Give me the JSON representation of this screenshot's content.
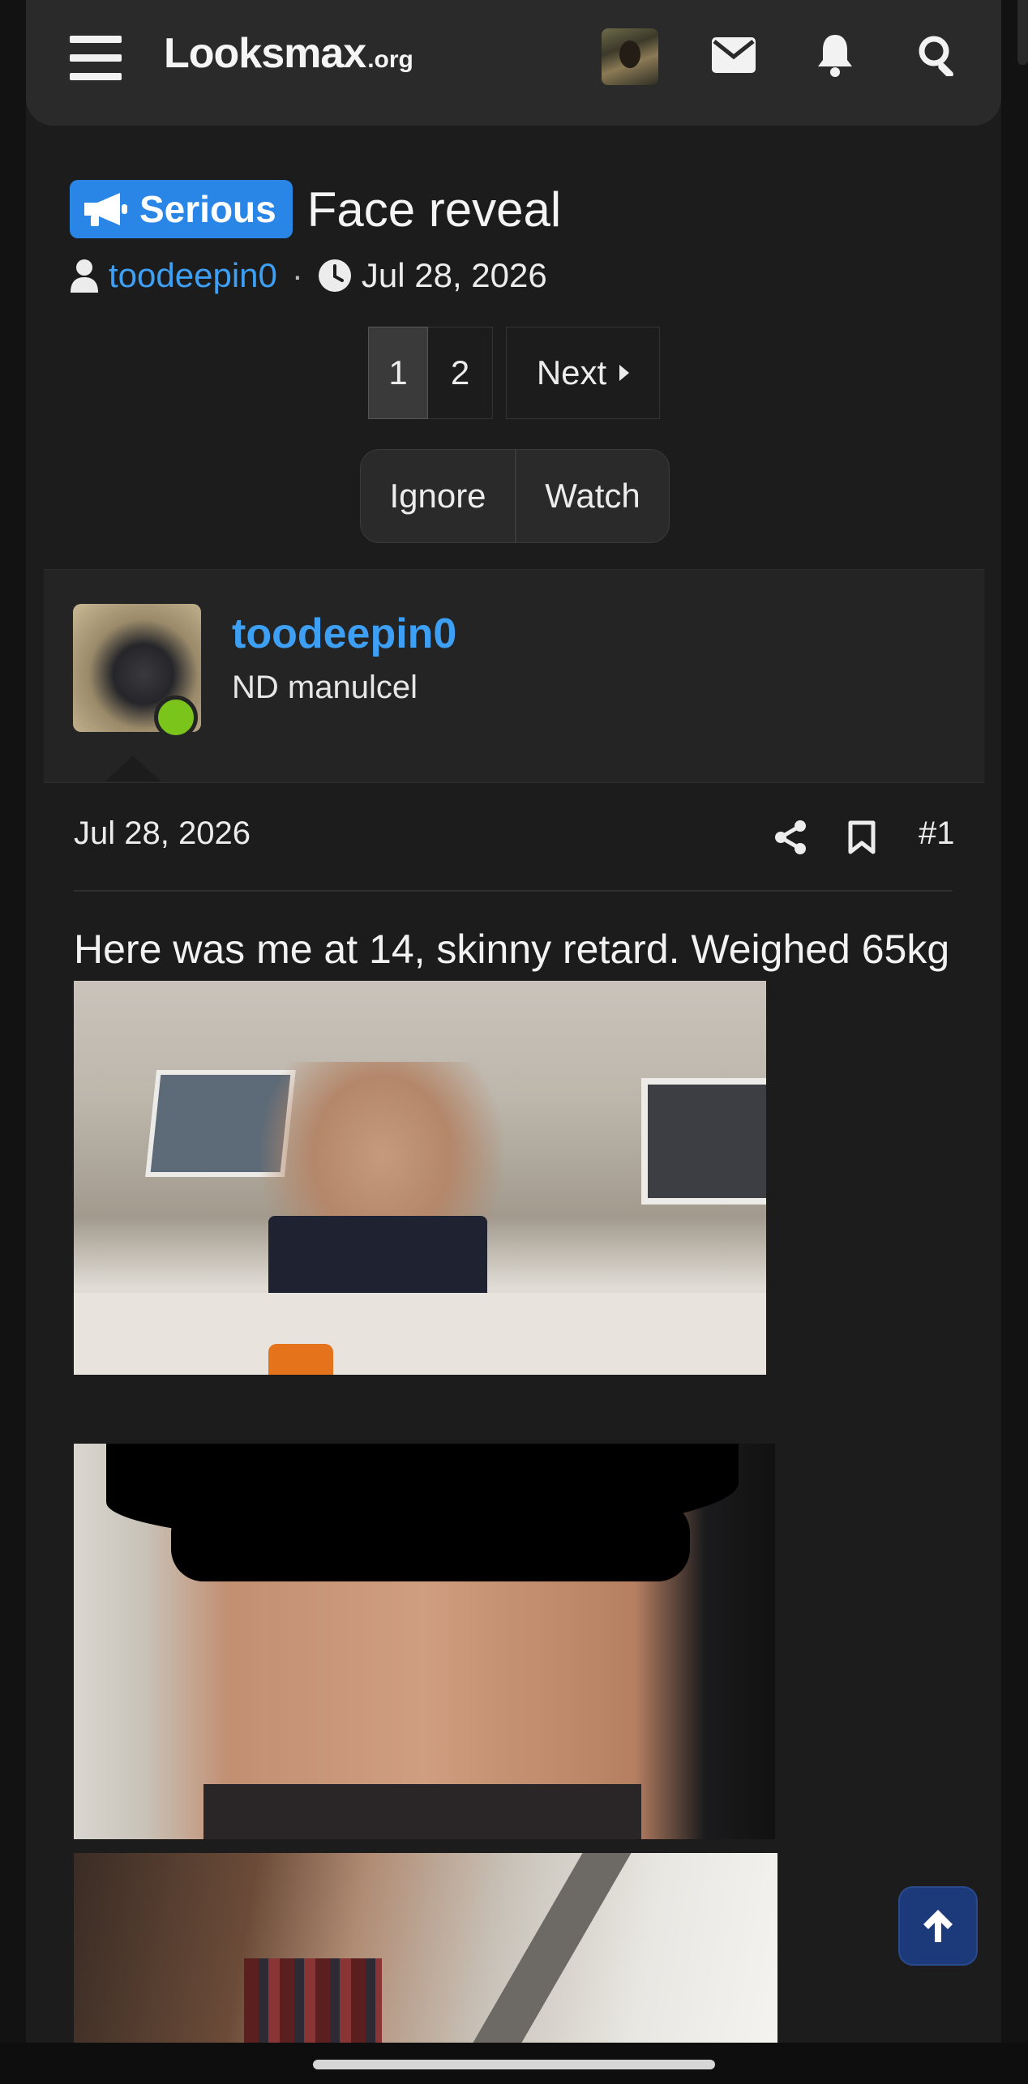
{
  "header": {
    "logo_main": "Looksmax",
    "logo_tld": ".org",
    "icons": [
      "menu-icon",
      "avatar",
      "envelope-icon",
      "bell-icon",
      "search-icon"
    ]
  },
  "thread": {
    "prefix_label": "Serious",
    "title": "Face reveal",
    "author": "toodeepin0",
    "separator": "·",
    "date": "Jul 28, 2026"
  },
  "pagination": {
    "pages": [
      "1",
      "2"
    ],
    "current_page": "1",
    "next_label": "Next"
  },
  "thread_actions": {
    "ignore_label": "Ignore",
    "watch_label": "Watch"
  },
  "post": {
    "user_name": "toodeepin0",
    "user_title": "ND manulcel",
    "date": "Jul 28, 2026",
    "number": "#1",
    "text": "Here was me at 14, skinny retard. Weighed 65kg"
  },
  "colors": {
    "accent": "#2a86e6",
    "link": "#3ea0f5",
    "online": "#7ac41c",
    "background": "#1c1c1c",
    "header_bg": "#2a2a2a"
  }
}
